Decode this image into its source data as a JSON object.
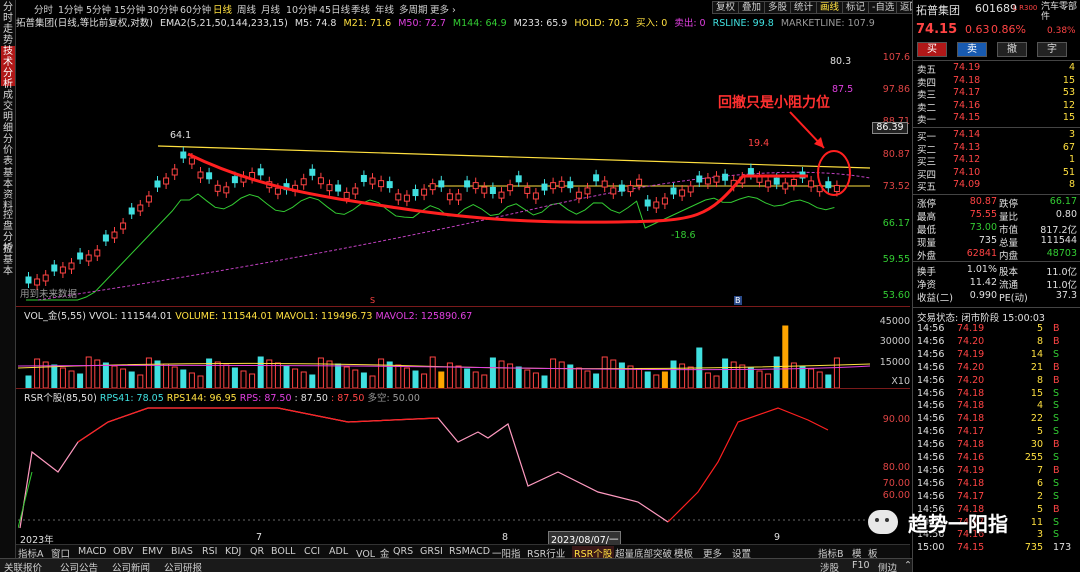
{
  "left_tabs": [
    "分时走势",
    "技术分析",
    "成交明细",
    "分价表",
    "基本资料",
    "控盘分析",
    "控基本"
  ],
  "periods": [
    "分时",
    "1分钟",
    "5分钟",
    "15分钟",
    "30分钟",
    "60分钟",
    "日线",
    "周线",
    "月线",
    "10分钟",
    "45日线",
    "季线",
    "年线",
    "多周期",
    "更多 ›"
  ],
  "active_period": "日线",
  "tool_buttons": [
    "复权",
    "叠加",
    "多股",
    "统计",
    "画线",
    "标记",
    "-自选",
    "返回"
  ],
  "active_tool": "画线",
  "indicator_line": {
    "name": "拓普集团(日线,等比前复权,对数)",
    "ema": "EMA2(5,21,50,144,233,15)",
    "m5": "M5: 74.8",
    "m21": "M21: 71.6",
    "m50": "M50: 72.7",
    "m144": "M144: 64.9",
    "m233": "M233: 65.9",
    "hold": "HOLD: 70.3",
    "buy": "买入: 0",
    "sell": "卖出: 0",
    "rsline": "RSLINE: 99.8",
    "marketline": "MARKETLINE: 107.9"
  },
  "price_axis": [
    "107.6",
    "97.86",
    "88.71",
    "80.87",
    "73.52",
    "66.17",
    "59.55",
    "53.60"
  ],
  "price_current_box": "86.39",
  "annotations": {
    "high": "64.1",
    "high2": "19.4",
    "low": "-18.6",
    "top1": "80.3",
    "top2": "87.5",
    "callout": "回撤只是小阻力位",
    "future_hint": "用到未来数据",
    "marker_s": "S",
    "marker_b": "B"
  },
  "volume_line": {
    "label": "VOL_金(5,55)",
    "vvol": "VVOL: 111544.01",
    "volume": "VOLUME: 111544.01",
    "mavol1": "MAVOL1: 119496.73",
    "mavol2": "MAVOL2: 125890.67"
  },
  "volume_axis": [
    "45000",
    "30000",
    "15000",
    "X10"
  ],
  "rsr_line": {
    "label": "RSR个股(85,50)",
    "rps41": "RPS41: 78.05",
    "rps144": "RPS144: 96.95",
    "rps": "RPS: 87.50",
    "rps2": ": 87.50",
    "rps3": ": 87.50",
    "duokong": "多空: 50.00"
  },
  "rsr_axis": [
    "90.00",
    "80.00",
    "70.00",
    "60.00"
  ],
  "date_labels": {
    "year": "2023年",
    "m7": "7",
    "m8": "8",
    "cursor": "2023/08/07/一",
    "m9": "9"
  },
  "bottom_tabs": [
    "指标A",
    "窗口",
    "MACD",
    "OBV",
    "EMV",
    "BIAS",
    "RSI",
    "KDJ",
    "QR",
    "BOLL",
    "CCI",
    "ADL",
    "VOL_金",
    "QRS",
    "GRSI",
    "RSMACD",
    "一阳指",
    "RSR行业",
    "RSR个股",
    "超量底部突破",
    "模板",
    "更多",
    "设置"
  ],
  "active_bottom": "RSR个股",
  "bottom_right": [
    "指标B",
    "模",
    "板"
  ],
  "status_bar": [
    "关联报价",
    "公司公告",
    "公司新闻",
    "公司研报"
  ],
  "status_right": [
    "涉股",
    "F10",
    "侧边",
    "⌃"
  ],
  "stock": {
    "name": "拓普集团",
    "code": "601689",
    "flags": "L R300",
    "sector": "汽车零部件",
    "price": "74.15",
    "change": "0.63",
    "pct": "0.86%",
    "sector_pct": "0.38%"
  },
  "trade_buttons": [
    "买",
    "卖",
    "撤",
    "字"
  ],
  "asks": [
    [
      "卖五",
      "74.19",
      "4"
    ],
    [
      "卖四",
      "74.18",
      "15"
    ],
    [
      "卖三",
      "74.17",
      "53"
    ],
    [
      "卖二",
      "74.16",
      "12"
    ],
    [
      "卖一",
      "74.15",
      "15"
    ]
  ],
  "bids": [
    [
      "买一",
      "74.14",
      "3"
    ],
    [
      "买二",
      "74.13",
      "67"
    ],
    [
      "买三",
      "74.12",
      "1"
    ],
    [
      "买四",
      "74.10",
      "51"
    ],
    [
      "买五",
      "74.09",
      "8"
    ]
  ],
  "stats": [
    [
      "涨停",
      "80.87",
      "跌停",
      "66.17"
    ],
    [
      "最高",
      "75.55",
      "量比",
      "0.80"
    ],
    [
      "最低",
      "73.00",
      "市值",
      "817.2亿"
    ],
    [
      "现量",
      "735",
      "总量",
      "111544"
    ],
    [
      "外盘",
      "62841",
      "内盘",
      "48703"
    ],
    [
      "换手",
      "1.01%",
      "股本",
      "11.0亿"
    ],
    [
      "净资",
      "11.42",
      "流通",
      "11.0亿"
    ],
    [
      "收益(二)",
      "0.990",
      "PE(动)",
      "37.3"
    ]
  ],
  "trade_status": "交易状态: 闭市阶段 15:00:03",
  "ticks": [
    [
      "14:56",
      "74.19",
      "5",
      "B"
    ],
    [
      "14:56",
      "74.20",
      "8",
      "B"
    ],
    [
      "14:56",
      "74.19",
      "14",
      "S"
    ],
    [
      "14:56",
      "74.20",
      "21",
      "B"
    ],
    [
      "14:56",
      "74.20",
      "8",
      "B"
    ],
    [
      "14:56",
      "74.18",
      "15",
      "S"
    ],
    [
      "14:56",
      "74.18",
      "4",
      "S"
    ],
    [
      "14:56",
      "74.18",
      "22",
      "S"
    ],
    [
      "14:56",
      "74.17",
      "5",
      "S"
    ],
    [
      "14:56",
      "74.18",
      "30",
      "B"
    ],
    [
      "14:56",
      "74.16",
      "255",
      "S"
    ],
    [
      "14:56",
      "74.19",
      "7",
      "B"
    ],
    [
      "14:56",
      "74.18",
      "6",
      "S"
    ],
    [
      "14:56",
      "74.17",
      "2",
      "S"
    ],
    [
      "14:56",
      "74.18",
      "5",
      "B"
    ],
    [
      "14:56",
      "74.17",
      "11",
      "S"
    ],
    [
      "14:56",
      "74.16",
      "3",
      "S"
    ],
    [
      "15:00",
      "74.15",
      "735",
      "173"
    ]
  ],
  "watermark": "趋势一阳指",
  "colors": {
    "up": "#ff4444",
    "down": "#40e0e0",
    "yellow": "#ffe040",
    "green": "#33cc33",
    "magenta": "#e040e0",
    "callout": "#ff2020"
  }
}
